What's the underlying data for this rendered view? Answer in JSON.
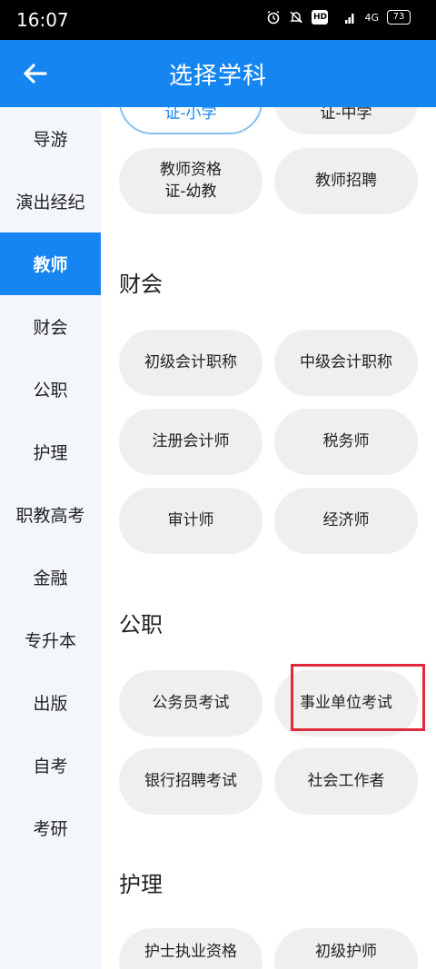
{
  "status_bar": {
    "time": "16:07",
    "network": "4G",
    "battery": "73"
  },
  "header": {
    "title": "选择学科"
  },
  "sidebar": {
    "items": [
      {
        "label": "导游"
      },
      {
        "label": "演出经纪"
      },
      {
        "label": "教师",
        "active": true
      },
      {
        "label": "财会"
      },
      {
        "label": "公职"
      },
      {
        "label": "护理"
      },
      {
        "label": "职教高考"
      },
      {
        "label": "金融"
      },
      {
        "label": "专升本"
      },
      {
        "label": "出版"
      },
      {
        "label": "自考"
      },
      {
        "label": "考研"
      }
    ]
  },
  "teacher_partial": {
    "chips": [
      {
        "label": "证-小学"
      },
      {
        "label": "证-中学"
      },
      {
        "label_line1": "教师资格",
        "label_line2": "证-幼教"
      },
      {
        "label": "教师招聘"
      }
    ]
  },
  "sections": [
    {
      "title": "财会",
      "chips": [
        {
          "label": "初级会计职称"
        },
        {
          "label": "中级会计职称"
        },
        {
          "label": "注册会计师"
        },
        {
          "label": "税务师"
        },
        {
          "label": "审计师"
        },
        {
          "label": "经济师"
        }
      ]
    },
    {
      "title": "公职",
      "chips": [
        {
          "label": "公务员考试"
        },
        {
          "label": "事业单位考试"
        },
        {
          "label": "银行招聘考试"
        },
        {
          "label": "社会工作者"
        }
      ]
    },
    {
      "title": "护理",
      "chips": [
        {
          "label": "护士执业资格"
        },
        {
          "label": "初级护师"
        }
      ]
    }
  ],
  "colors": {
    "primary": "#1585f2",
    "highlight": "#e02a3c",
    "chip_bg": "#efefef"
  }
}
